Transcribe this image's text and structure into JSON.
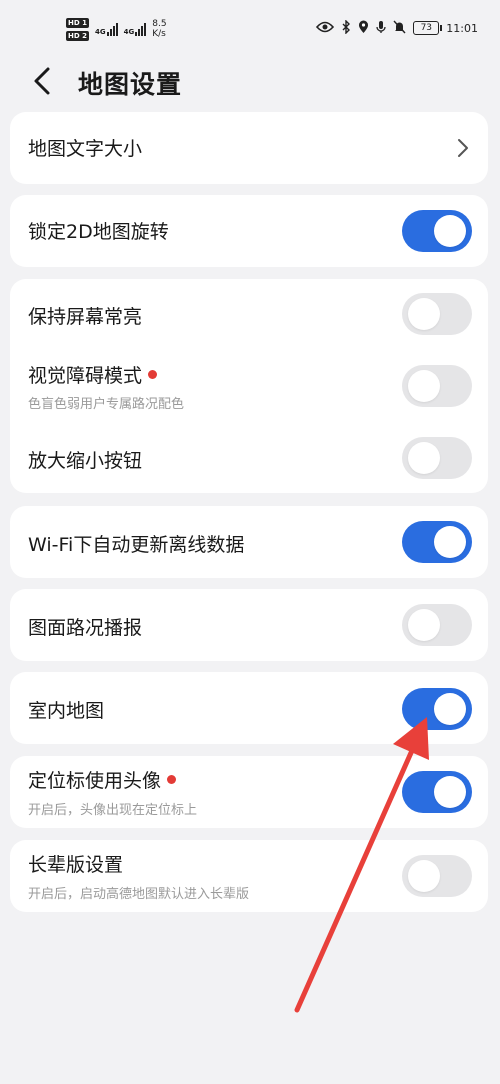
{
  "status_bar": {
    "hd_1": "HD 1",
    "hd_2": "HD 2",
    "net_4g_1": "4G",
    "net_4g_2": "4G",
    "speed_value": "8.5",
    "speed_unit": "K/s",
    "battery": "73",
    "time": "11:01"
  },
  "header": {
    "title": "地图设置"
  },
  "settings": {
    "map_text_size": {
      "label": "地图文字大小"
    },
    "lock_2d_rotation": {
      "label": "锁定2D地图旋转",
      "on": true
    },
    "keep_screen_on": {
      "label": "保持屏幕常亮",
      "on": false
    },
    "visual_impaired": {
      "label": "视觉障碍模式",
      "sub": "色盲色弱用户专属路况配色",
      "on": false
    },
    "zoom_buttons": {
      "label": "放大缩小按钮",
      "on": false
    },
    "wifi_offline": {
      "label": "Wi-Fi下自动更新离线数据",
      "on": true
    },
    "traffic_broadcast": {
      "label": "图面路况播报",
      "on": false
    },
    "indoor_map": {
      "label": "室内地图",
      "on": true
    },
    "avatar_marker": {
      "label": "定位标使用头像",
      "sub": "开启后，头像出现在定位标上",
      "on": true
    },
    "elder_mode": {
      "label": "长辈版设置",
      "sub": "开启后，启动高德地图默认进入长辈版",
      "on": false
    }
  },
  "colors": {
    "toggle_on": "#2a6de0",
    "toggle_off": "#e5e5e7",
    "red_dot": "#e33b36",
    "annotation_arrow": "#e8403a"
  }
}
